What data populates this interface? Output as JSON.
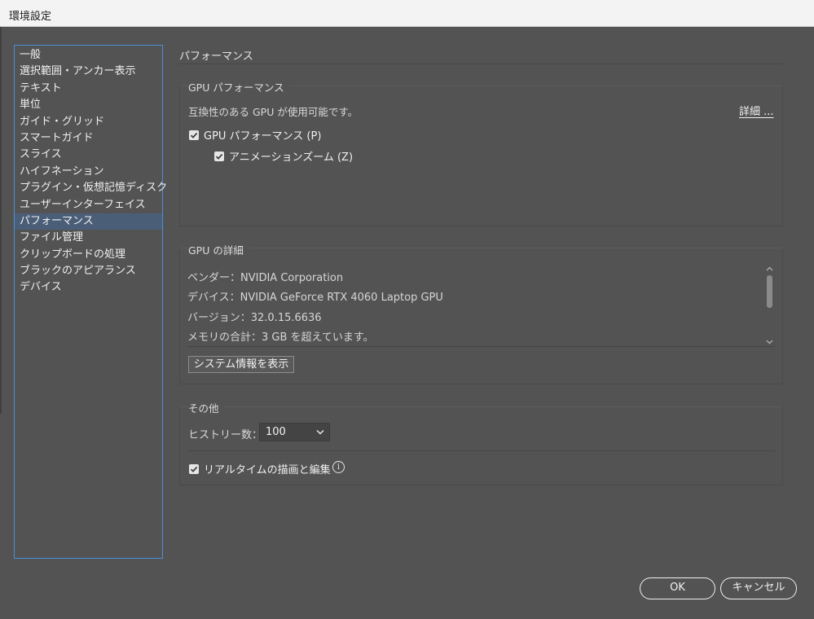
{
  "window": {
    "title": "環境設定"
  },
  "sidebar": {
    "items": [
      {
        "label": "一般"
      },
      {
        "label": "選択範囲・アンカー表示"
      },
      {
        "label": "テキスト"
      },
      {
        "label": "単位"
      },
      {
        "label": "ガイド・グリッド"
      },
      {
        "label": "スマートガイド"
      },
      {
        "label": "スライス"
      },
      {
        "label": "ハイフネーション"
      },
      {
        "label": "プラグイン・仮想記憶ディスク"
      },
      {
        "label": "ユーザーインターフェイス"
      },
      {
        "label": "パフォーマンス",
        "selected": true
      },
      {
        "label": "ファイル管理"
      },
      {
        "label": "クリップボードの処理"
      },
      {
        "label": "ブラックのアピアランス"
      },
      {
        "label": "デバイス"
      }
    ]
  },
  "main": {
    "section_title": "パフォーマンス",
    "gpu_performance": {
      "group_label": "GPU パフォーマンス",
      "status_text": "互換性のある GPU が使用可能です。",
      "details_link": "詳細 ...",
      "gpu_checkbox": {
        "label": "GPU パフォーマンス (P)",
        "checked": true
      },
      "zoom_checkbox": {
        "label": "アニメーションズーム (Z)",
        "checked": true
      }
    },
    "gpu_details": {
      "group_label": "GPU の詳細",
      "vendor": "ベンダー：NVIDIA Corporation",
      "device": "デバイス：NVIDIA GeForce RTX 4060 Laptop GPU",
      "version": "バージョン：32.0.15.6636",
      "memory": "メモリの合計：3 GB を超えています。",
      "system_info_button": "システム情報を表示"
    },
    "other": {
      "group_label": "その他",
      "history_label": "ヒストリー数：",
      "history_value": "100",
      "realtime_checkbox": {
        "label": "リアルタイムの描画と編集",
        "checked": true
      }
    }
  },
  "footer": {
    "ok_label": "OK",
    "cancel_label": "キャンセル"
  },
  "colors": {
    "background": "#535353",
    "selection": "#4b5e78",
    "accent_border": "#4a90d9"
  }
}
